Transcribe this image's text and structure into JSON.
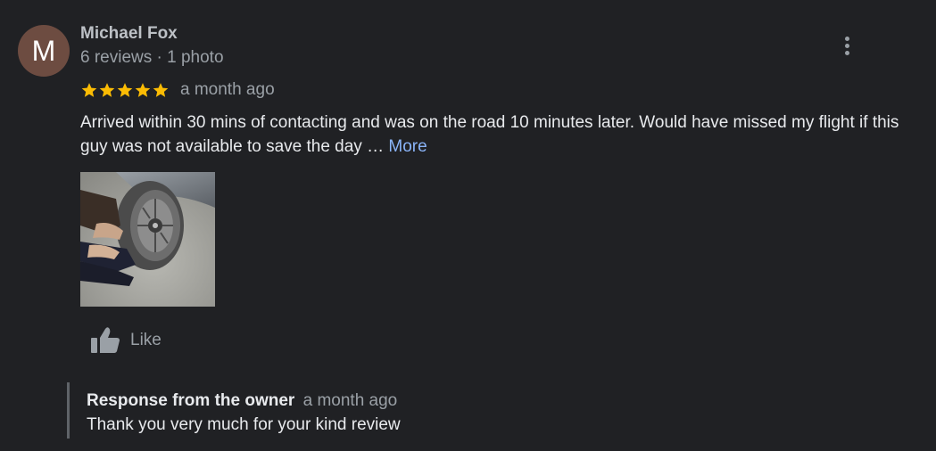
{
  "review": {
    "author": {
      "initial": "M",
      "name": "Michael Fox",
      "meta": "6 reviews · 1 photo",
      "avatar_color": "#6d4c41"
    },
    "rating": 5,
    "date": "a month ago",
    "text": "Arrived within 30 mins of contacting and was on the road 10 minutes later. Would have missed my flight if this guy was not available to save the day …",
    "more_label": "More",
    "photo_count": 1,
    "like_label": "Like",
    "menu_icon": "more-vert-icon",
    "star_color": "#fbbc04",
    "link_color": "#8ab4f8"
  },
  "owner_response": {
    "title": "Response from the owner",
    "date": "a month ago",
    "text": "Thank you very much for your kind review"
  }
}
